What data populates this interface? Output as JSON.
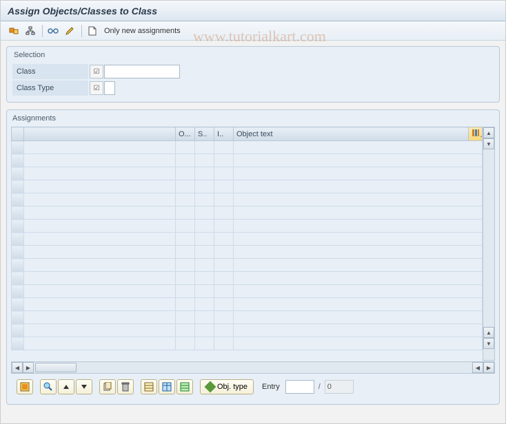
{
  "title": "Assign Objects/Classes to Class",
  "toolbar": {
    "only_new_assignments": "Only new assignments"
  },
  "selection": {
    "group_title": "Selection",
    "class_label": "Class",
    "class_type_label": "Class Type",
    "class_value": "",
    "class_type_value": ""
  },
  "assignments": {
    "group_title": "Assignments",
    "columns": {
      "selector": "",
      "main": "",
      "o": "O...",
      "s": "S..",
      "i": "I..",
      "object_text": "Object text"
    },
    "row_count": 16
  },
  "footer": {
    "obj_type_label": "Obj. type",
    "entry_label": "Entry",
    "entry_value": "",
    "entry_total": "0"
  },
  "watermark": "www.tutorialkart.com"
}
